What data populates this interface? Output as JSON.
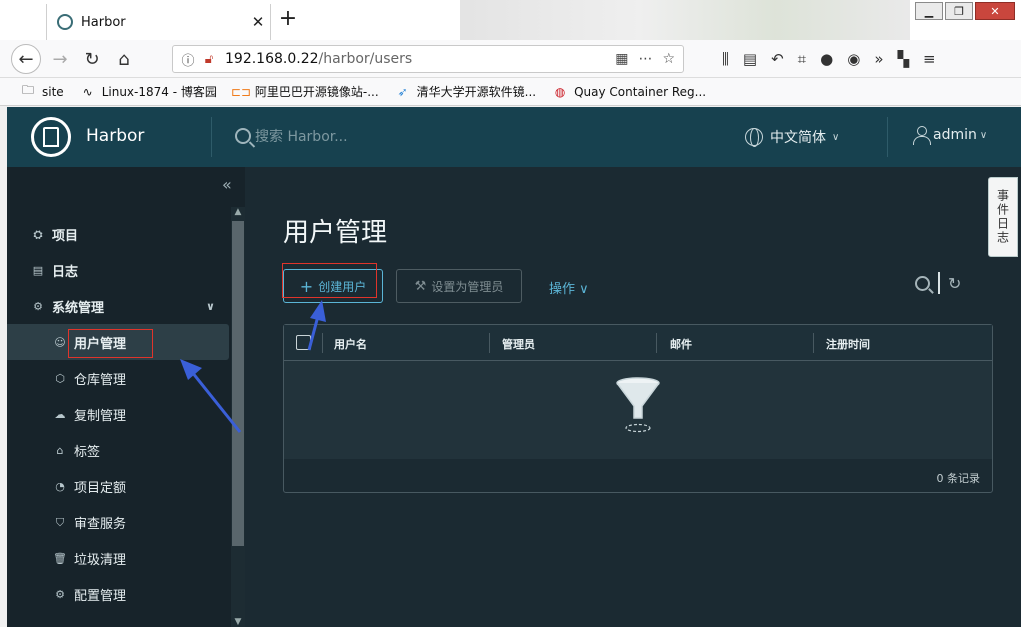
{
  "browser": {
    "tab_title": "Harbor",
    "tab_close": "✕",
    "new_tab": "+",
    "url_host": "192.168.0.22",
    "url_path": "/harbor/users",
    "url_actions": [
      "⋯",
      "☆"
    ],
    "bookmarks": [
      {
        "icon": "folder-icon",
        "label": "site"
      },
      {
        "icon": "penguin-icon",
        "label": "Linux-1874 - 博客园"
      },
      {
        "icon": "alibaba-icon",
        "label": "阿里巴巴开源镜像站-..."
      },
      {
        "icon": "tsinghua-icon",
        "label": "清华大学开源软件镜..."
      },
      {
        "icon": "quay-icon",
        "label": "Quay Container Reg..."
      }
    ]
  },
  "header": {
    "brand": "Harbor",
    "search_placeholder": "搜索 Harbor...",
    "language": "中文简体",
    "user": "admin"
  },
  "sidebar": {
    "collapse_glyph": "«",
    "items": [
      {
        "label": "项目",
        "icon": "projects-icon"
      },
      {
        "label": "日志",
        "icon": "logs-icon"
      },
      {
        "label": "系统管理",
        "icon": "admin-icon"
      }
    ],
    "sub_items": [
      {
        "label": "用户管理",
        "icon": "users-icon",
        "active": true
      },
      {
        "label": "仓库管理",
        "icon": "box-icon"
      },
      {
        "label": "复制管理",
        "icon": "cloud-icon"
      },
      {
        "label": "标签",
        "icon": "tag-icon"
      },
      {
        "label": "项目定额",
        "icon": "gauge-icon"
      },
      {
        "label": "审查服务",
        "icon": "shield-icon"
      },
      {
        "label": "垃圾清理",
        "icon": "trash-icon"
      },
      {
        "label": "配置管理",
        "icon": "gear-icon"
      }
    ]
  },
  "main": {
    "title": "用户管理",
    "create_user": "创建用户",
    "set_admin": "设置为管理员",
    "operations": "操作",
    "columns": [
      "用户名",
      "管理员",
      "邮件",
      "注册时间"
    ],
    "footer": "0 条记录"
  },
  "event_tab": "事件日志",
  "colors": {
    "header_bg": "#17414f",
    "sidebar_bg": "#17232a",
    "main_bg": "#1b2a32",
    "accent": "#5bb5d6",
    "annotation_red": "#e0342b",
    "annotation_arrow": "#3a5fd8"
  }
}
